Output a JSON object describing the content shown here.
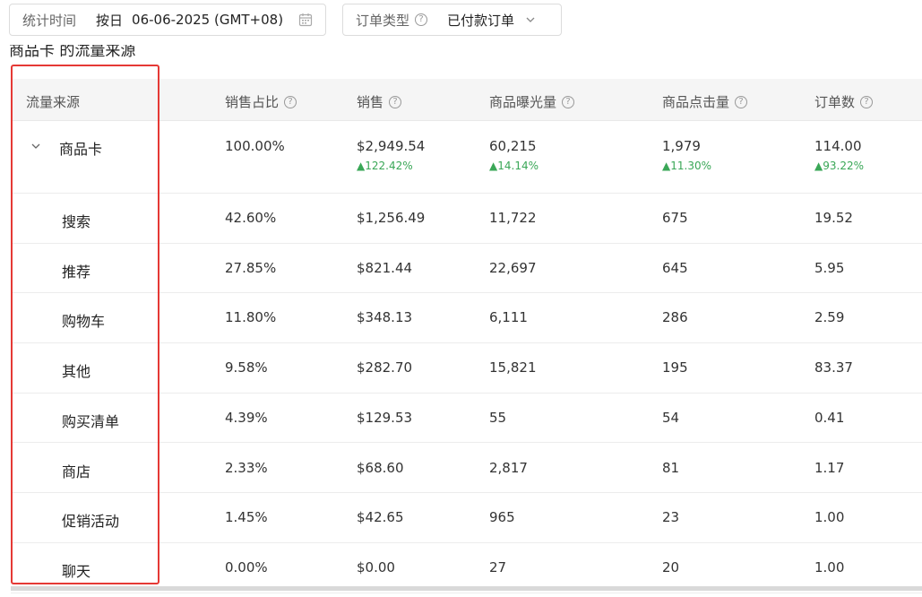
{
  "filters": {
    "date_label": "统计时间",
    "date_mode": "按日",
    "date_value": "06-06-2025 (GMT+08)",
    "order_type_label": "订单类型",
    "order_type_value": "已付款订单"
  },
  "section_title": "商品卡 的流量来源",
  "table": {
    "headers": [
      "流量来源",
      "销售占比",
      "销售",
      "商品曝光量",
      "商品点击量",
      "订单数"
    ],
    "parent": {
      "source": "商品卡",
      "share": "100.00%",
      "sales": "$2,949.54",
      "sales_delta": "▲122.42%",
      "impressions": "60,215",
      "impressions_delta": "▲14.14%",
      "clicks": "1,979",
      "clicks_delta": "▲11.30%",
      "orders": "114.00",
      "orders_delta": "▲93.22%"
    },
    "rows": [
      {
        "source": "搜索",
        "share": "42.60%",
        "sales": "$1,256.49",
        "impressions": "11,722",
        "clicks": "675",
        "orders": "19.52"
      },
      {
        "source": "推荐",
        "share": "27.85%",
        "sales": "$821.44",
        "impressions": "22,697",
        "clicks": "645",
        "orders": "5.95"
      },
      {
        "source": "购物车",
        "share": "11.80%",
        "sales": "$348.13",
        "impressions": "6,111",
        "clicks": "286",
        "orders": "2.59"
      },
      {
        "source": "其他",
        "share": "9.58%",
        "sales": "$282.70",
        "impressions": "15,821",
        "clicks": "195",
        "orders": "83.37"
      },
      {
        "source": "购买清单",
        "share": "4.39%",
        "sales": "$129.53",
        "impressions": "55",
        "clicks": "54",
        "orders": "0.41"
      },
      {
        "source": "商店",
        "share": "2.33%",
        "sales": "$68.60",
        "impressions": "2,817",
        "clicks": "81",
        "orders": "1.17"
      },
      {
        "source": "促销活动",
        "share": "1.45%",
        "sales": "$42.65",
        "impressions": "965",
        "clicks": "23",
        "orders": "1.00"
      },
      {
        "source": "聊天",
        "share": "0.00%",
        "sales": "$0.00",
        "impressions": "27",
        "clicks": "20",
        "orders": "1.00"
      }
    ]
  },
  "colors": {
    "highlight_border": "#e53935",
    "delta_up": "#3aa757"
  }
}
